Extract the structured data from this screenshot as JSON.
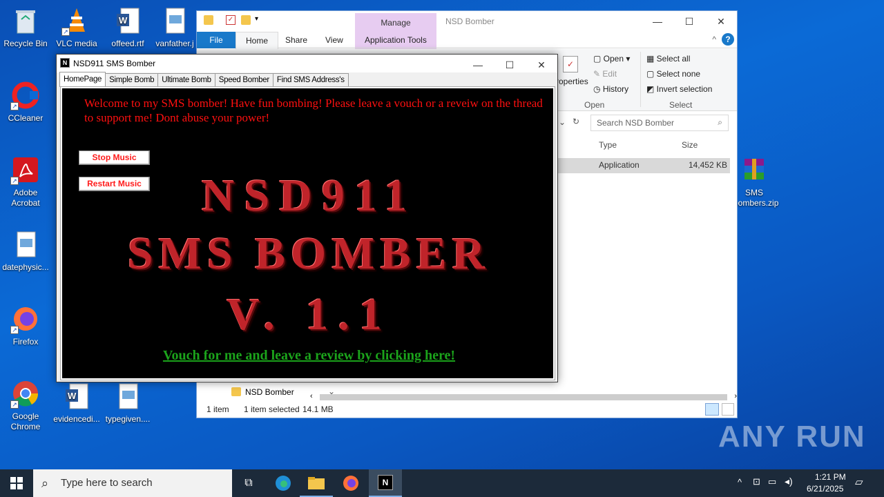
{
  "desktop": {
    "icons": [
      {
        "label": "Recycle Bin"
      },
      {
        "label": "VLC media"
      },
      {
        "label": "offeed.rtf"
      },
      {
        "label": "vanfather.j"
      },
      {
        "label": "CCleaner"
      },
      {
        "label": "Adobe Acrobat"
      },
      {
        "label": "datephysic..."
      },
      {
        "label": "Firefox"
      },
      {
        "label": "Google Chrome"
      },
      {
        "label": "evidencedi..."
      },
      {
        "label": "typegiven...."
      },
      {
        "label": "SMS bombers.zip"
      }
    ]
  },
  "explorer": {
    "title": "NSD Bomber",
    "manage_label": "Manage",
    "tabs": [
      "File",
      "Home",
      "Share",
      "View",
      "Application Tools"
    ],
    "ribbon": {
      "properties": "roperties",
      "open": "Open",
      "edit": "Edit",
      "history": "History",
      "open_group": "Open",
      "select_all": "Select all",
      "select_none": "Select none",
      "invert_selection": "Invert selection",
      "select_group": "Select"
    },
    "search_placeholder": "Search NSD Bomber",
    "columns": {
      "type": "Type",
      "size": "Size"
    },
    "row": {
      "type": "Application",
      "size": "14,452 KB"
    },
    "nav_folder": "NSD Bomber",
    "status": {
      "count": "1 item",
      "selected": "1 item selected",
      "size": "14.1 MB"
    }
  },
  "sms_app": {
    "title": "NSD911 SMS Bomber",
    "tabs": [
      "HomePage",
      "Simple Bomb",
      "Ultimate Bomb",
      "Speed Bomber",
      "Find SMS Address's"
    ],
    "welcome": "Welcome to my SMS bomber! Have fun bombing! Please leave a vouch or a reveiw on the thread to support me! Dont abuse your power!",
    "stop_music": "Stop Music",
    "restart_music": "Restart Music",
    "big_line1": "NSD911",
    "big_line2": "SMS BOMBER",
    "big_line3": "V. 1.1",
    "vouch_link": "Vouch for me and leave a review by clicking here!"
  },
  "taskbar": {
    "search_placeholder": "Type here to search",
    "time": "1:21 PM",
    "date": "6/21/2025"
  },
  "watermark": "ANY RUN"
}
